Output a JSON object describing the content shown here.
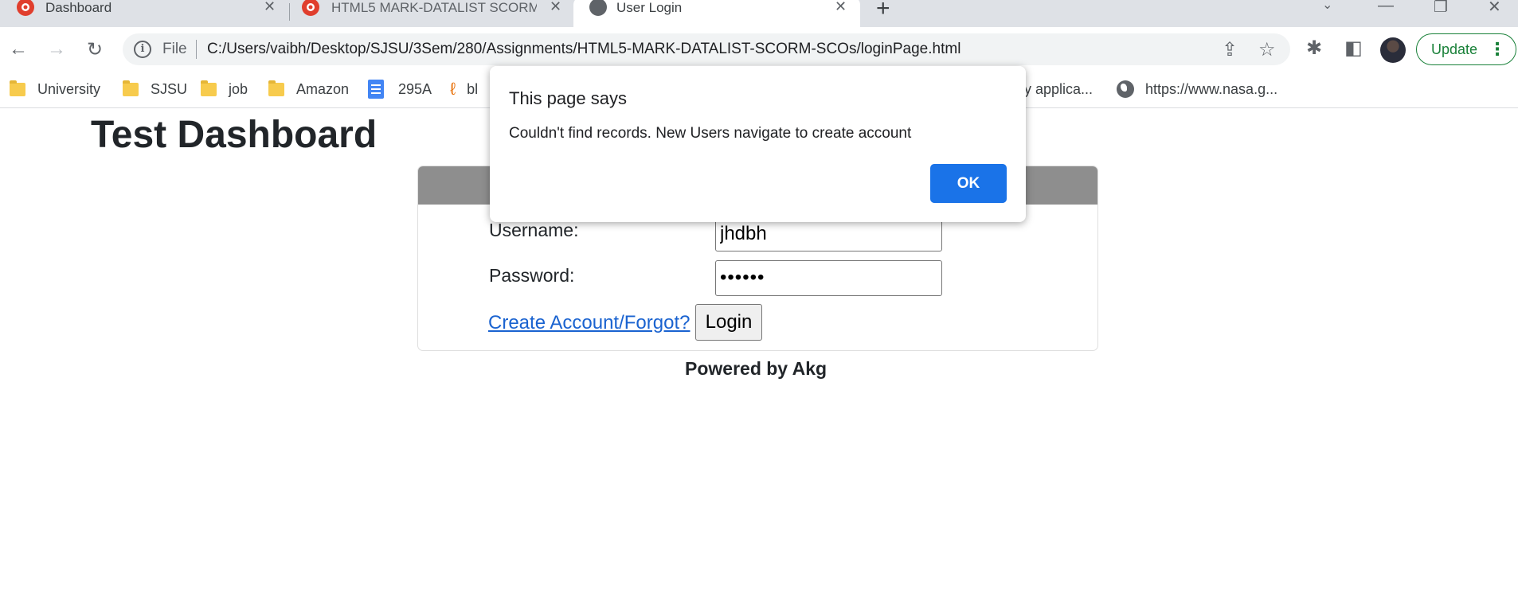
{
  "browser": {
    "tabs": [
      {
        "title": "Dashboard",
        "active": false
      },
      {
        "title": "HTML5 MARK-DATALIST SCORM",
        "active": false
      },
      {
        "title": "User Login",
        "active": true
      }
    ],
    "address": {
      "scheme_label": "File",
      "url": "C:/Users/vaibh/Desktop/SJSU/3Sem/280/Assignments/HTML5-MARK-DATALIST-SCORM-SCOs/loginPage.html"
    },
    "update_label": "Update",
    "bookmarks": [
      {
        "label": "University",
        "icon": "folder-icon"
      },
      {
        "label": "SJSU",
        "icon": "folder-icon"
      },
      {
        "label": "job",
        "icon": "folder-icon"
      },
      {
        "label": "Amazon",
        "icon": "folder-icon"
      },
      {
        "label": "295A",
        "icon": "docs-icon"
      },
      {
        "label": "bl",
        "icon": "site-icon"
      },
      {
        "label": "ly applica...",
        "icon": "none"
      },
      {
        "label": "https://www.nasa.g...",
        "icon": "globe-icon"
      }
    ]
  },
  "page": {
    "title": "Test Dashboard",
    "form": {
      "username_label": "Username:",
      "username_value": "jhdbh",
      "password_label": "Password:",
      "password_value": "••••••",
      "create_link": "Create Account/Forgot?",
      "login_button": "Login"
    },
    "footer": "Powered by Akg"
  },
  "dialog": {
    "title": "This page says",
    "message": "Couldn't find records. New Users navigate to create account",
    "ok_label": "OK"
  },
  "colors": {
    "accent": "#1a73e8",
    "update_green": "#188038",
    "card_header": "#8e8e8e",
    "link": "#1a63d0"
  }
}
